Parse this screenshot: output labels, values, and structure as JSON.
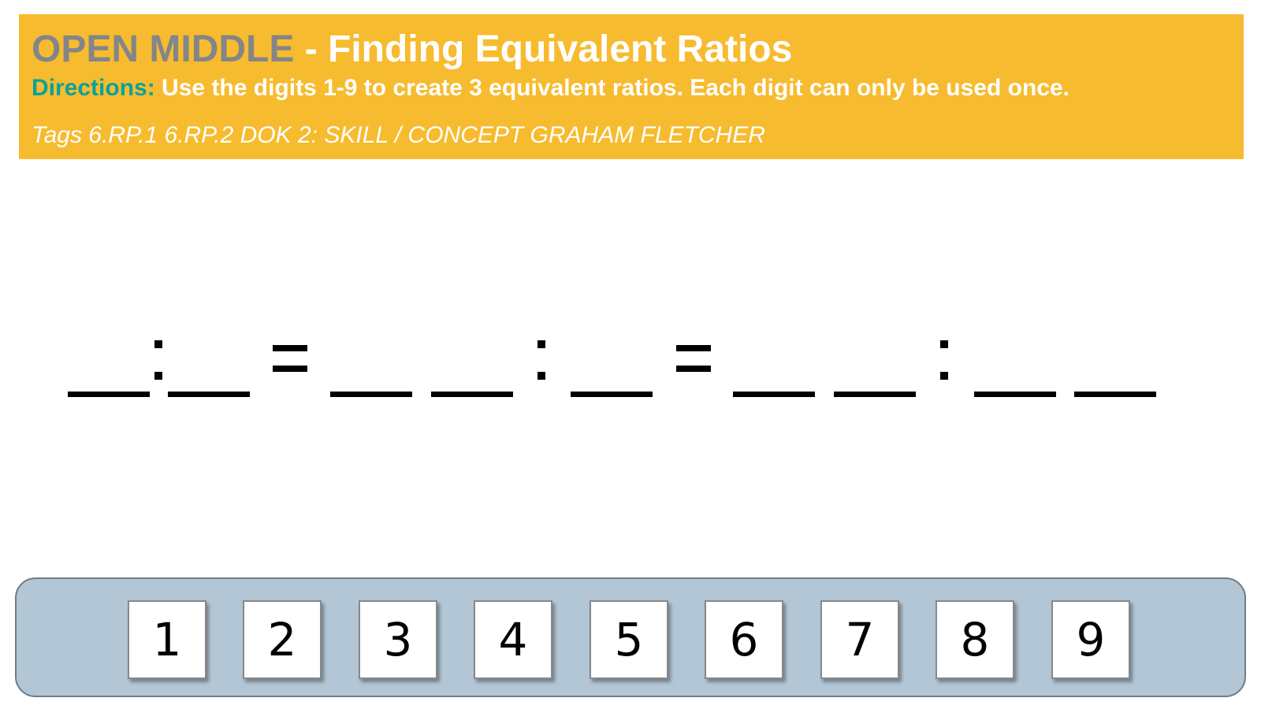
{
  "header": {
    "brand": "OPEN MIDDLE",
    "title": " - Finding Equivalent Ratios",
    "directions_label": "Directions:",
    "directions_text": " Use the digits 1-9 to create 3 equivalent ratios. Each digit can only be used once.",
    "tags": "Tags 6.RP.1 6.RP.2 DOK 2: SKILL / CONCEPT GRAHAM FLETCHER"
  },
  "colors": {
    "banner": "#f7bb2f",
    "brand_text": "#838689",
    "directions_label": "#0aa19a",
    "tray": "#b2c6d6"
  },
  "puzzle": {
    "ratios": [
      {
        "left_blanks": 1,
        "right_blanks": 1
      },
      {
        "left_blanks": 2,
        "right_blanks": 1
      },
      {
        "left_blanks": 2,
        "right_blanks": 2
      }
    ]
  },
  "digit_tiles": [
    "1",
    "2",
    "3",
    "4",
    "5",
    "6",
    "7",
    "8",
    "9"
  ]
}
